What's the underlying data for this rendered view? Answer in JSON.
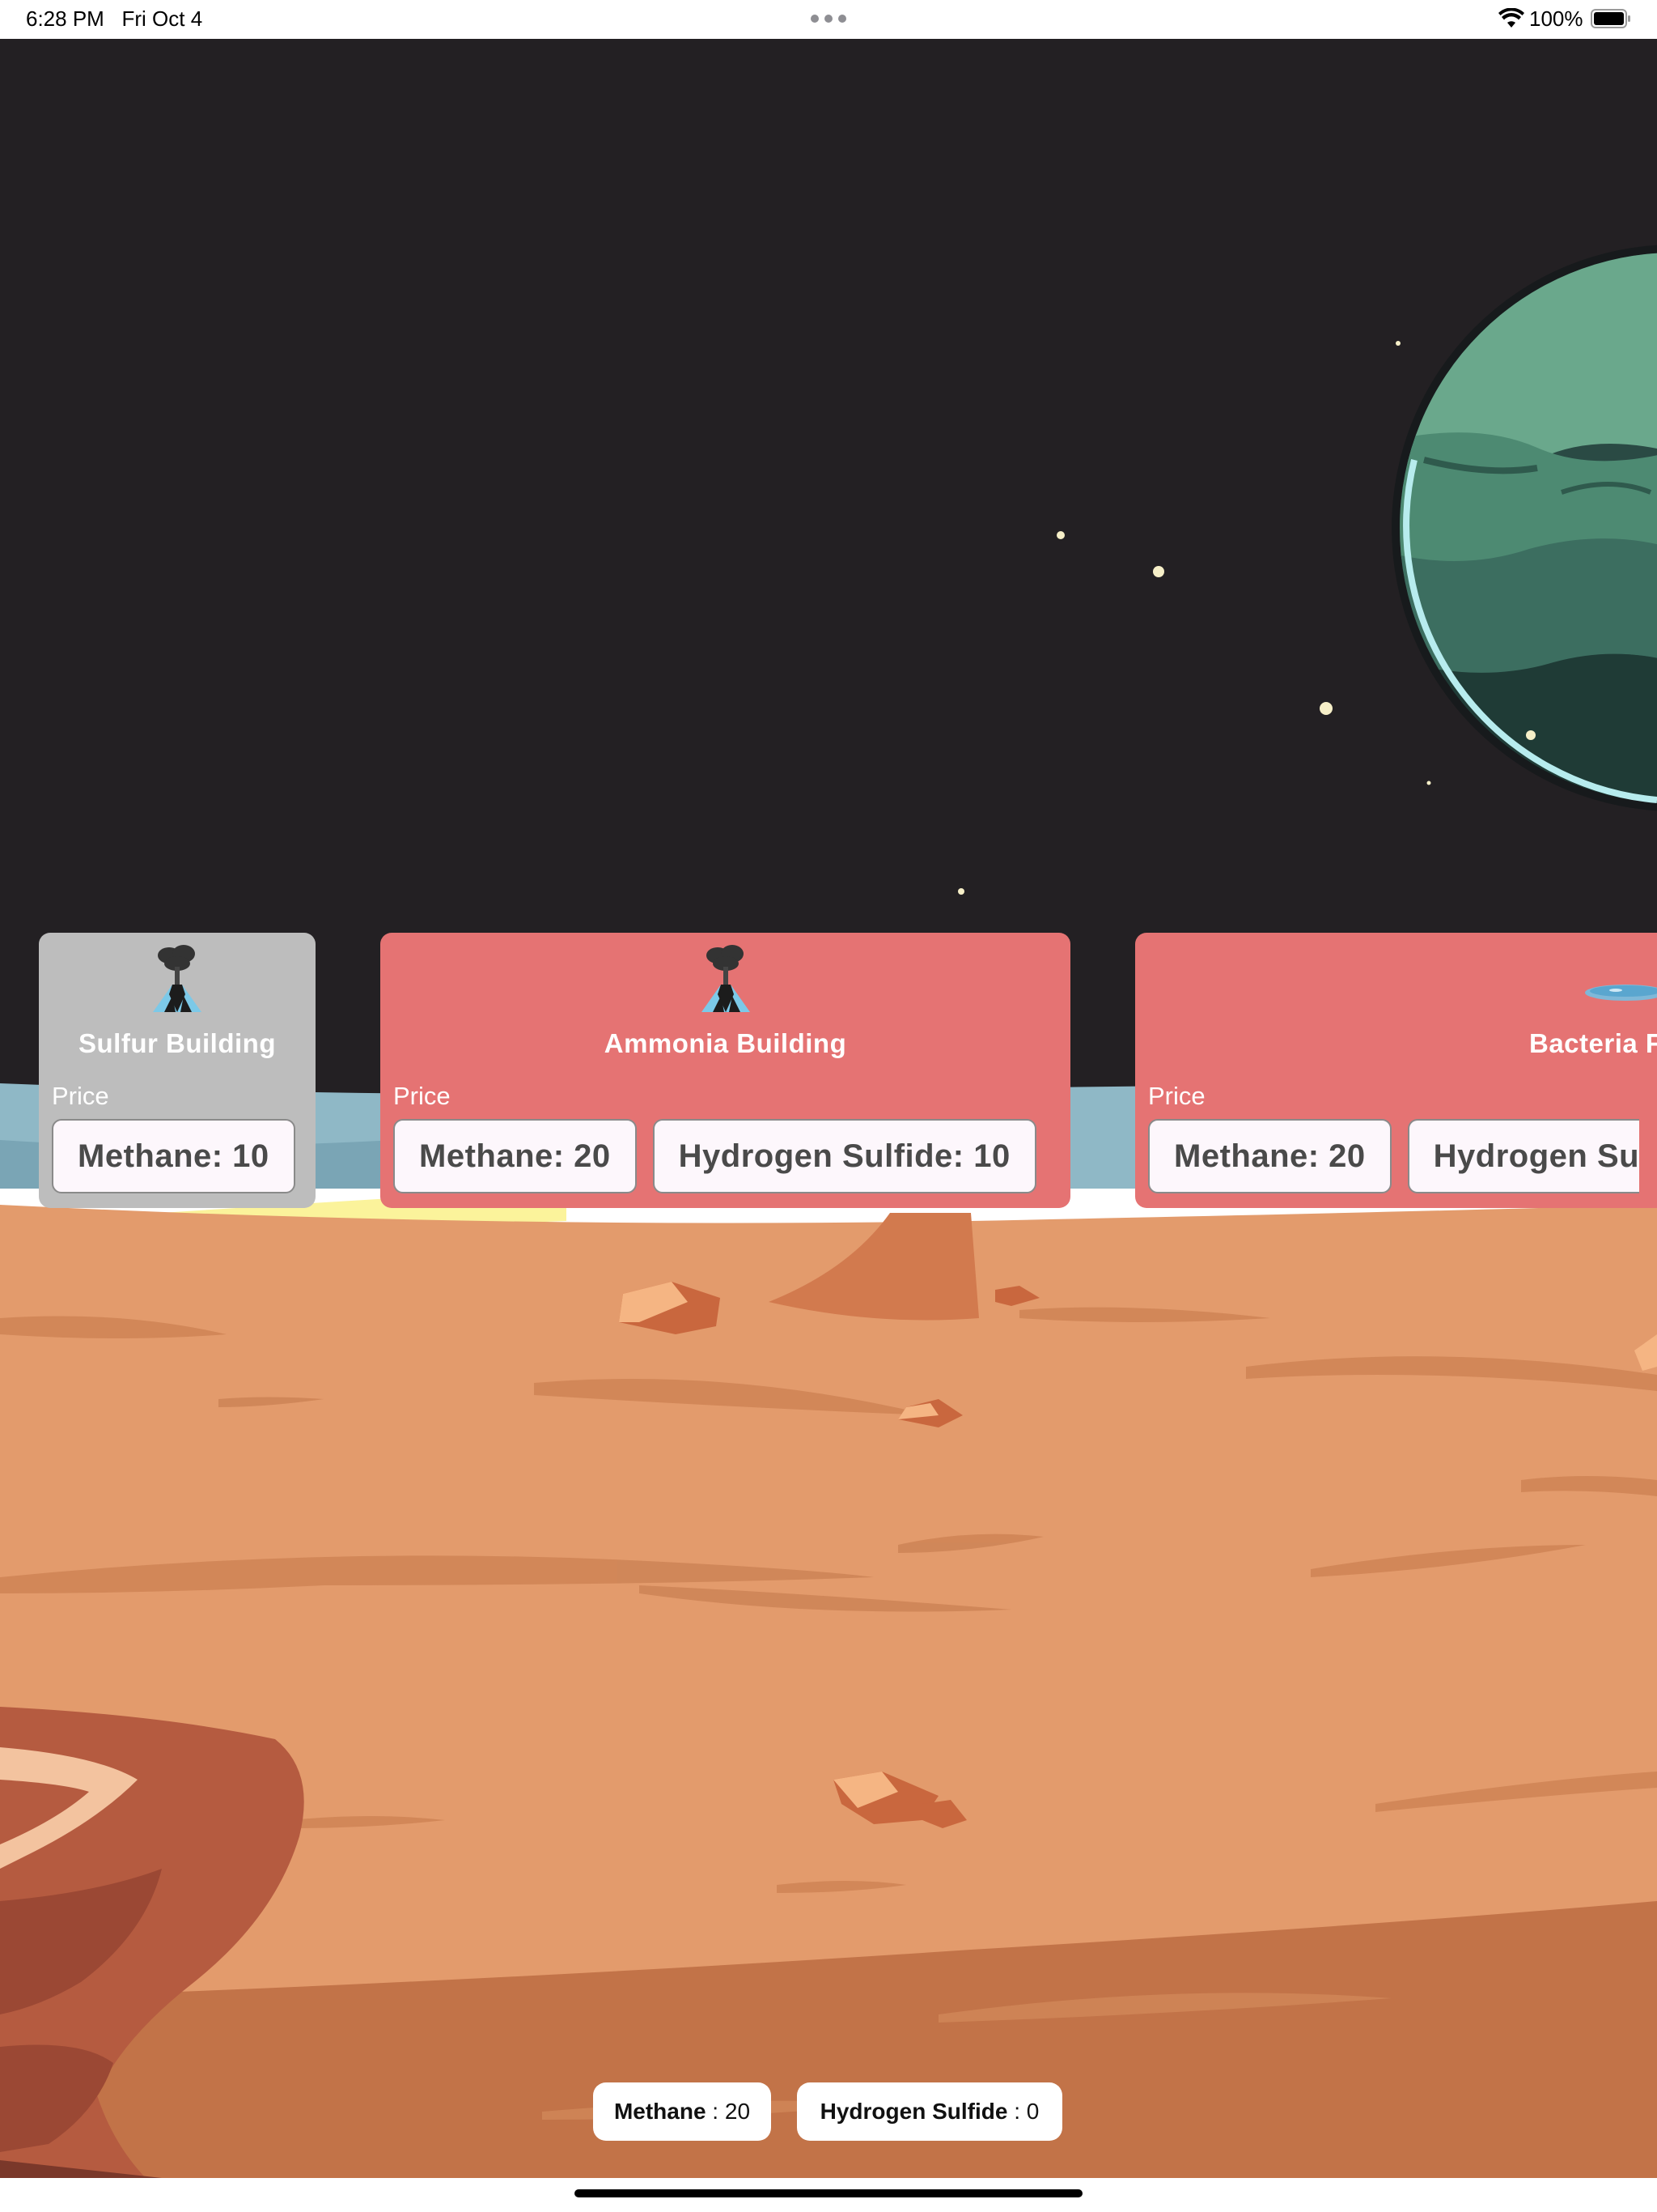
{
  "status_bar": {
    "time": "6:28 PM",
    "date": "Fri Oct 4",
    "battery_percent": "100%",
    "battery_level": 1.0
  },
  "cards": [
    {
      "title": "Sulfur Building",
      "price_label": "Price",
      "state": "locked",
      "icon": "volcano-icon",
      "prices": [
        "Methane: 10"
      ]
    },
    {
      "title": "Ammonia Building",
      "price_label": "Price",
      "state": "available",
      "icon": "volcano-icon",
      "prices": [
        "Methane: 20",
        "Hydrogen Sulfide: 10"
      ]
    },
    {
      "title": "Bacteria F",
      "price_label": "Price",
      "state": "available",
      "icon": "pond-icon",
      "prices": [
        "Methane: 20",
        "Hydrogen Su"
      ]
    }
  ],
  "resources": [
    {
      "name": "Methane",
      "separator": " : ",
      "value": "20"
    },
    {
      "name": "Hydrogen Sulfide",
      "separator": " : ",
      "value": "0"
    }
  ],
  "colors": {
    "space": "#232023",
    "ground": "#e39b6c",
    "card_locked": "#bdbdbd",
    "card_available": "#e57373",
    "planet": "#4f8f78"
  }
}
